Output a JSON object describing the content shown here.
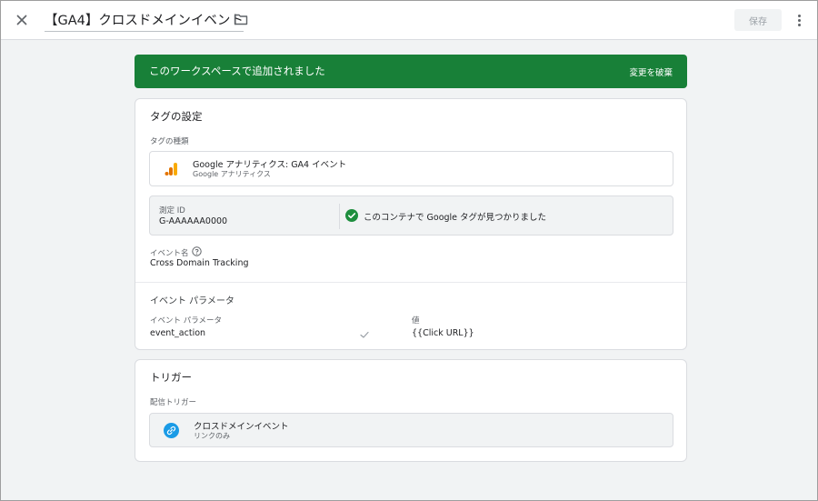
{
  "header": {
    "title": "【GA4】クロスドメインイベント",
    "save_label": "保存"
  },
  "banner": {
    "text": "このワークスペースで追加されました",
    "discard_label": "変更を破棄",
    "color": "#188038"
  },
  "tag_config": {
    "title": "タグの設定",
    "tag_type_label": "タグの種類",
    "tag_type": {
      "name": "Google アナリティクス: GA4 イベント",
      "sub": "Google アナリティクス",
      "icon": "google-analytics-icon"
    },
    "measurement": {
      "label": "測定 ID",
      "value": "G-AAAAAA0000",
      "status": "このコンテナで Google タグが見つかりました"
    },
    "event_name": {
      "label": "イベント名",
      "value": "Cross Domain Tracking"
    },
    "event_params": {
      "section_title": "イベント パラメータ",
      "col_param": "イベント パラメータ",
      "col_value": "値",
      "rows": [
        {
          "param": "event_action",
          "value": "{{Click URL}}"
        }
      ]
    }
  },
  "trigger": {
    "title": "トリガー",
    "firing_label": "配信トリガー",
    "item": {
      "name": "クロスドメインイベント",
      "sub": "リンクのみ",
      "icon": "link-icon",
      "icon_color": "#1a9be6"
    }
  }
}
